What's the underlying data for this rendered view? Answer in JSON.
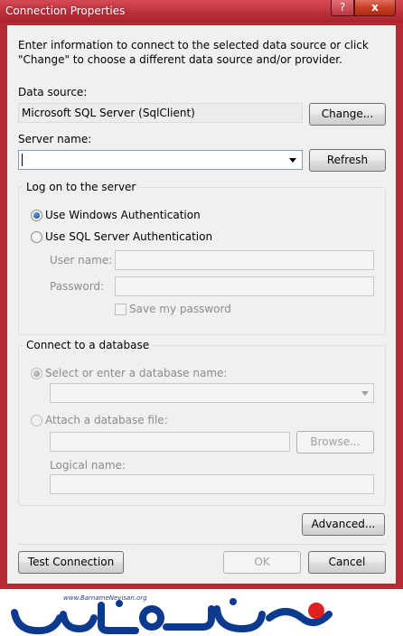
{
  "window": {
    "title": "Connection Properties",
    "help_glyph": "?",
    "close_glyph": "x"
  },
  "intro": "Enter information to connect to the selected data source or click \"Change\" to choose a different data source and/or provider.",
  "data_source": {
    "label": "Data source:",
    "value": "Microsoft SQL Server (SqlClient)",
    "change_button": "Change..."
  },
  "server_name": {
    "label": "Server name:",
    "value": "",
    "refresh_button": "Refresh"
  },
  "log_on": {
    "group_title": "Log on to the server",
    "windows_auth": "Use Windows Authentication",
    "sql_auth": "Use SQL Server Authentication",
    "user_name_label": "User name:",
    "password_label": "Password:",
    "save_password": "Save my password",
    "selected": "windows"
  },
  "connect_db": {
    "group_title": "Connect to a database",
    "select_db": "Select or enter a database name:",
    "attach_file": "Attach a database file:",
    "browse_button": "Browse...",
    "logical_name_label": "Logical name:"
  },
  "buttons": {
    "advanced": "Advanced...",
    "test_connection": "Test Connection",
    "ok": "OK",
    "cancel": "Cancel"
  },
  "logo": {
    "url_text": "www.BarnameNevisan.org",
    "wordmark": "برنامه نویسان",
    "color": "#0b3a8f",
    "accent": "#e02020"
  },
  "colors": {
    "title_bar": "#b8303b",
    "dialog_bg": "#f0f0f0"
  }
}
